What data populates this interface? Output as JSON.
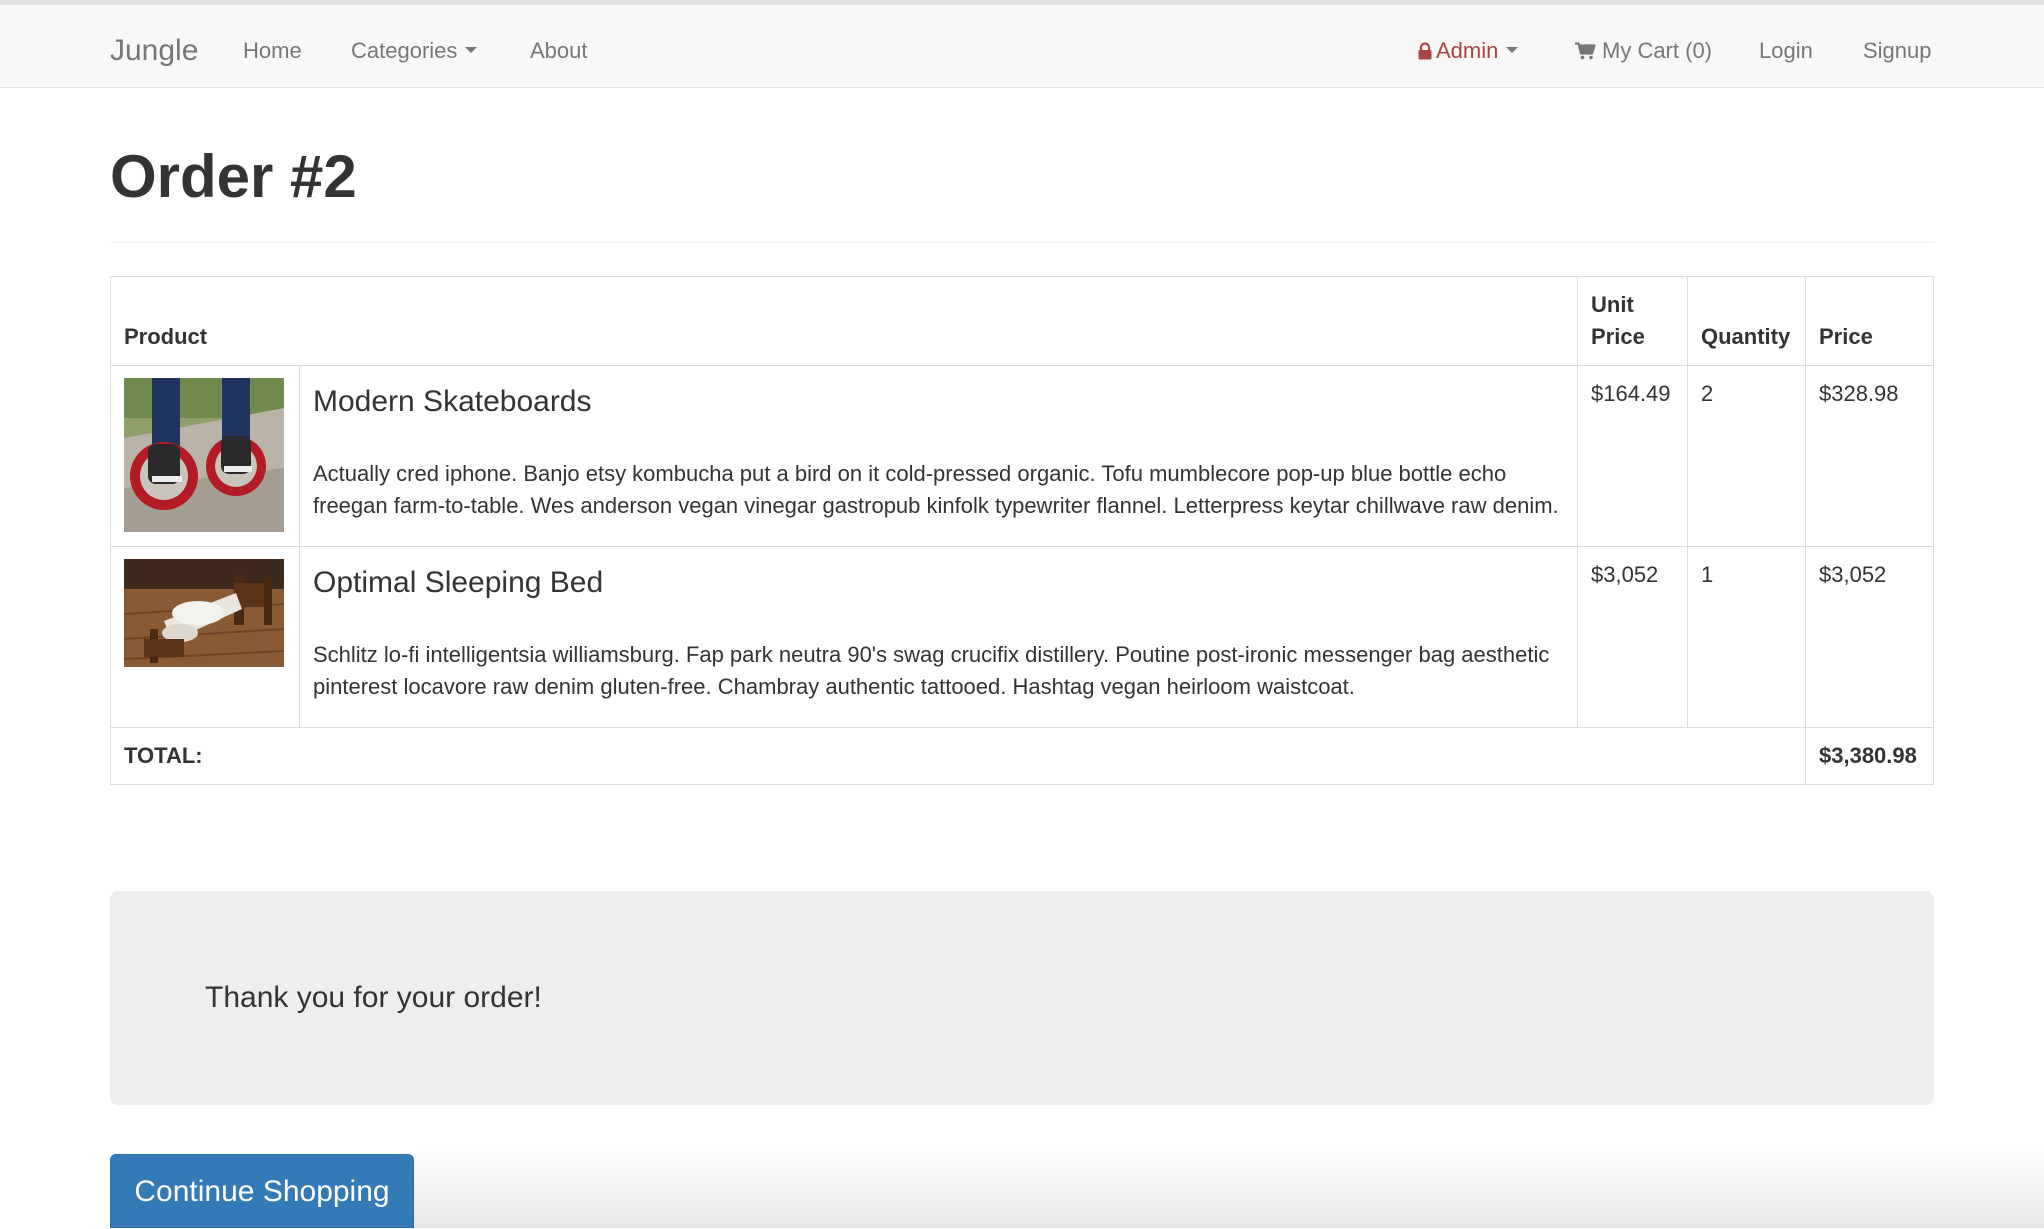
{
  "navbar": {
    "brand": "Jungle",
    "home": "Home",
    "categories": "Categories",
    "about": "About",
    "admin": "Admin",
    "cart": "My Cart (0)",
    "login": "Login",
    "signup": "Signup"
  },
  "page": {
    "title": "Order #2"
  },
  "table": {
    "headers": {
      "product": "Product",
      "unit_price_line1": "Unit",
      "unit_price_line2": "Price",
      "quantity": "Quantity",
      "price": "Price"
    },
    "rows": [
      {
        "image_icon": "skateboard-photo",
        "name": "Modern Skateboards",
        "description": "Actually cred iphone. Banjo etsy kombucha put a bird on it cold-pressed organic. Tofu mumblecore pop-up blue bottle echo freegan farm-to-table. Wes anderson vegan vinegar gastropub kinfolk typewriter flannel. Letterpress keytar chillwave raw denim.",
        "unit_price": "$164.49",
        "quantity": "2",
        "price": "$328.98"
      },
      {
        "image_icon": "bed-photo",
        "name": "Optimal Sleeping Bed",
        "description": "Schlitz lo-fi intelligentsia williamsburg. Fap park neutra 90's swag crucifix distillery. Poutine post-ironic messenger bag aesthetic pinterest locavore raw denim gluten-free. Chambray authentic tattooed. Hashtag vegan heirloom waistcoat.",
        "unit_price": "$3,052",
        "quantity": "1",
        "price": "$3,052"
      }
    ],
    "total_label": "TOTAL:",
    "total_value": "$3,380.98"
  },
  "thanks": {
    "message": "Thank you for your order!"
  },
  "actions": {
    "continue_label": "Continue Shopping"
  },
  "colors": {
    "navbar_bg": "#f8f8f8",
    "admin_text": "#a94442",
    "button_primary": "#337ab7",
    "panel_bg": "#eeeeee"
  }
}
